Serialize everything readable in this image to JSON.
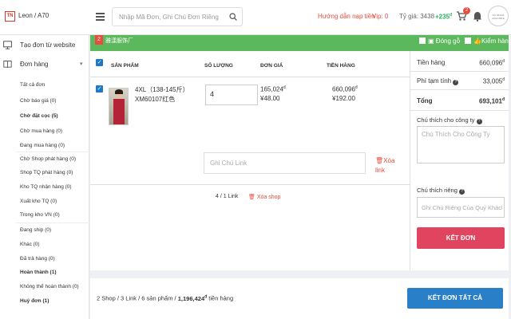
{
  "header": {
    "logo_text": "TN",
    "user": "Leon / A70",
    "search_placeholder": "Nhập Mã Đơn, Ghi Chú Đơn Riêng",
    "guide": "Hướng dẫn nạp tiền",
    "vip": "Vip: 0",
    "rate": "Tỷ giá: 3438",
    "balance": "+235",
    "currency_mark": "đ",
    "cart_count": "2",
    "avatar_text": "NO IMAGE AVAILABLE"
  },
  "sidebar": {
    "create_order": "Tạo đơn từ website",
    "orders": "Đơn hàng",
    "items": [
      {
        "label": "Tất cả đơn",
        "bold": false
      },
      {
        "label": "Chờ báo giá (0)",
        "bold": false
      },
      {
        "label": "Chờ đặt cọc (5)",
        "bold": true
      },
      {
        "label": "Chờ mua hàng (0)",
        "bold": false
      },
      {
        "label": "Đang mua hàng (0)",
        "bold": false
      },
      {
        "label": "Chờ Shop phát hàng (0)",
        "bold": false
      },
      {
        "label": "Shop TQ phát hàng (0)",
        "bold": false
      },
      {
        "label": "Kho TQ nhận hàng (0)",
        "bold": false
      },
      {
        "label": "Xuất kho TQ (0)",
        "bold": false
      },
      {
        "label": "Trong kho VN (0)",
        "bold": false
      },
      {
        "label": "Đang ship (0)",
        "bold": false
      },
      {
        "label": "Khác (0)",
        "bold": false
      },
      {
        "label": "Đã trả hàng (0)",
        "bold": false
      },
      {
        "label": "Hoàn thành (1)",
        "bold": true
      },
      {
        "label": "Không thể hoàn thành (0)",
        "bold": false
      },
      {
        "label": "Huỷ đơn (1)",
        "bold": true
      }
    ]
  },
  "shop": {
    "number": "2",
    "name": "雅漾服饰厂",
    "wood_pack": "Đóng gỗ",
    "inspect": "Kiểm hàng"
  },
  "table": {
    "headers": [
      "SẢN PHẨM",
      "SỐ LƯỢNG",
      "ĐƠN GIÁ",
      "TIỀN HÀNG"
    ],
    "product": {
      "size": "4XL（138-145斤）",
      "variant": "XM60107红色",
      "quantity": "4",
      "unit_price_vnd": "165,024",
      "unit_price_cny": "¥48.00",
      "total_vnd": "660,096",
      "total_cny": "¥192.00"
    },
    "note_placeholder": "Ghi Chú Link",
    "delete_link": "Xóa link",
    "links_count": "4 / 1 Link",
    "delete_shop": "Xóa shop"
  },
  "summary": {
    "goods_label": "Tiền hàng",
    "goods_value": "660,096",
    "fee_label": "Phí tạm tính",
    "fee_value": "33,005",
    "total_label": "Tổng",
    "total_value": "693,101",
    "company_note_label": "Chú thích cho công ty",
    "company_note_placeholder": "Chú Thích Cho Công Ty",
    "private_note_label": "Chú thích riêng",
    "private_note_placeholder": "Ghi Chú Riêng Của Quý Khách",
    "order_button": "KẾT ĐƠN"
  },
  "footer": {
    "prefix": "2 Shop / 3 Link / 6 sản phẩm /",
    "amount": "1,196,424",
    "suffix": "tiền hàng",
    "order_all_button": "KẾT ĐƠN TẤT CẢ"
  },
  "colors": {
    "shop_bar": "#5cb85c",
    "order_button": "#e0445f",
    "order_all_button": "#2a7fc9",
    "accent_red": "#e74c3c",
    "balance_green": "#27ae60"
  }
}
